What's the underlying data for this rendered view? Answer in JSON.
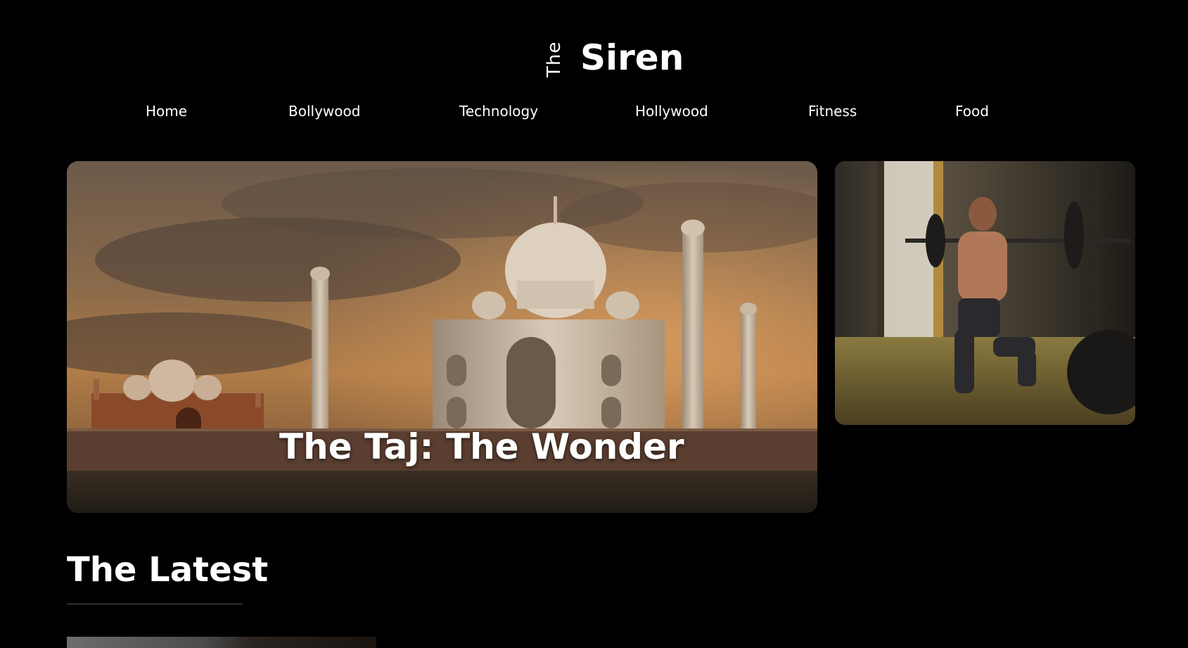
{
  "brand": {
    "prefix": "The",
    "name": "Siren"
  },
  "nav": {
    "items": [
      "Home",
      "Bollywood",
      "Technology",
      "Hollywood",
      "Fitness",
      "Food"
    ]
  },
  "featured": {
    "main_title": "The Taj: The Wonder",
    "side_image": "fitness-man-barbell-lunge"
  },
  "latest": {
    "heading": "The Latest"
  },
  "colors": {
    "background": "#000000",
    "text": "#ffffff"
  }
}
